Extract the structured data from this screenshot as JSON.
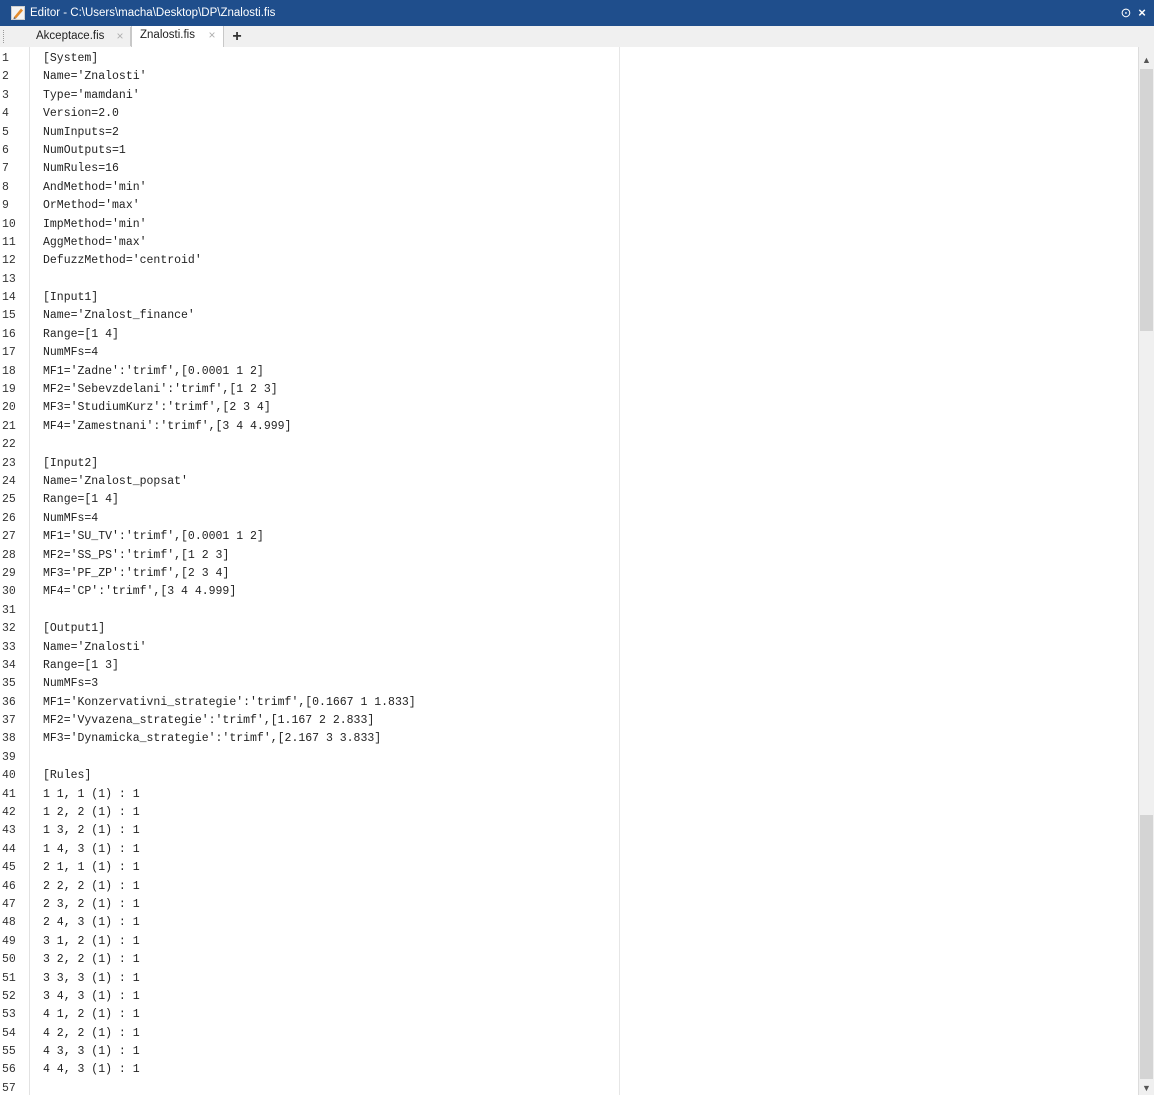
{
  "window": {
    "title": "Editor - C:\\Users\\macha\\Desktop\\DP\\Znalosti.fis",
    "controls": {
      "options": "⊙",
      "close": "×"
    }
  },
  "tabs": [
    {
      "label": "Akceptace.fis",
      "close": "×"
    },
    {
      "label": "Znalosti.fis",
      "close": "×"
    }
  ],
  "add_tab": "+",
  "code_lines": [
    {
      "n": "1",
      "text": "[System]"
    },
    {
      "n": "2",
      "text": "Name='Znalosti'"
    },
    {
      "n": "3",
      "text": "Type='mamdani'"
    },
    {
      "n": "4",
      "text": "Version=2.0"
    },
    {
      "n": "5",
      "text": "NumInputs=2"
    },
    {
      "n": "6",
      "text": "NumOutputs=1"
    },
    {
      "n": "7",
      "text": "NumRules=16"
    },
    {
      "n": "8",
      "text": "AndMethod='min'"
    },
    {
      "n": "9",
      "text": "OrMethod='max'"
    },
    {
      "n": "10",
      "text": "ImpMethod='min'"
    },
    {
      "n": "11",
      "text": "AggMethod='max'"
    },
    {
      "n": "12",
      "text": "DefuzzMethod='centroid'"
    },
    {
      "n": "13",
      "text": ""
    },
    {
      "n": "14",
      "text": "[Input1]"
    },
    {
      "n": "15",
      "text": "Name='Znalost_finance'"
    },
    {
      "n": "16",
      "text": "Range=[1 4]"
    },
    {
      "n": "17",
      "text": "NumMFs=4"
    },
    {
      "n": "18",
      "text": "MF1='Zadne':'trimf',[0.0001 1 2]"
    },
    {
      "n": "19",
      "text": "MF2='Sebevzdelani':'trimf',[1 2 3]"
    },
    {
      "n": "20",
      "text": "MF3='StudiumKurz':'trimf',[2 3 4]"
    },
    {
      "n": "21",
      "text": "MF4='Zamestnani':'trimf',[3 4 4.999]"
    },
    {
      "n": "22",
      "text": ""
    },
    {
      "n": "23",
      "text": "[Input2]"
    },
    {
      "n": "24",
      "text": "Name='Znalost_popsat'"
    },
    {
      "n": "25",
      "text": "Range=[1 4]"
    },
    {
      "n": "26",
      "text": "NumMFs=4"
    },
    {
      "n": "27",
      "text": "MF1='SU_TV':'trimf',[0.0001 1 2]"
    },
    {
      "n": "28",
      "text": "MF2='SS_PS':'trimf',[1 2 3]"
    },
    {
      "n": "29",
      "text": "MF3='PF_ZP':'trimf',[2 3 4]"
    },
    {
      "n": "30",
      "text": "MF4='CP':'trimf',[3 4 4.999]"
    },
    {
      "n": "31",
      "text": ""
    },
    {
      "n": "32",
      "text": "[Output1]"
    },
    {
      "n": "33",
      "text": "Name='Znalosti'"
    },
    {
      "n": "34",
      "text": "Range=[1 3]"
    },
    {
      "n": "35",
      "text": "NumMFs=3"
    },
    {
      "n": "36",
      "text": "MF1='Konzervativni_strategie':'trimf',[0.1667 1 1.833]"
    },
    {
      "n": "37",
      "text": "MF2='Vyvazena_strategie':'trimf',[1.167 2 2.833]"
    },
    {
      "n": "38",
      "text": "MF3='Dynamicka_strategie':'trimf',[2.167 3 3.833]"
    },
    {
      "n": "39",
      "text": ""
    },
    {
      "n": "40",
      "text": "[Rules]"
    },
    {
      "n": "41",
      "text": "1 1, 1 (1) : 1"
    },
    {
      "n": "42",
      "text": "1 2, 2 (1) : 1"
    },
    {
      "n": "43",
      "text": "1 3, 2 (1) : 1"
    },
    {
      "n": "44",
      "text": "1 4, 3 (1) : 1"
    },
    {
      "n": "45",
      "text": "2 1, 1 (1) : 1"
    },
    {
      "n": "46",
      "text": "2 2, 2 (1) : 1"
    },
    {
      "n": "47",
      "text": "2 3, 2 (1) : 1"
    },
    {
      "n": "48",
      "text": "2 4, 3 (1) : 1"
    },
    {
      "n": "49",
      "text": "3 1, 2 (1) : 1"
    },
    {
      "n": "50",
      "text": "3 2, 2 (1) : 1"
    },
    {
      "n": "51",
      "text": "3 3, 3 (1) : 1"
    },
    {
      "n": "52",
      "text": "3 4, 3 (1) : 1"
    },
    {
      "n": "53",
      "text": "4 1, 2 (1) : 1"
    },
    {
      "n": "54",
      "text": "4 2, 2 (1) : 1"
    },
    {
      "n": "55",
      "text": "4 3, 3 (1) : 1"
    },
    {
      "n": "56",
      "text": "4 4, 3 (1) : 1"
    },
    {
      "n": "57",
      "text": ""
    }
  ],
  "scrollbar": {
    "up": "▲",
    "down": "▼"
  },
  "colors": {
    "titlebar": "#1f4e8c",
    "tabbar": "#f0f0f0",
    "editor_bg": "#ffffff"
  }
}
